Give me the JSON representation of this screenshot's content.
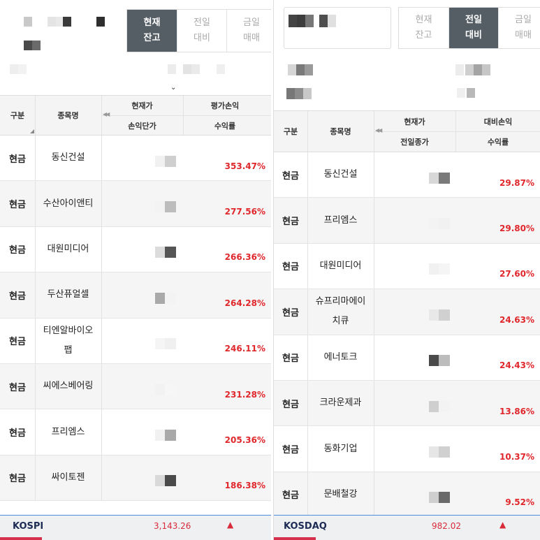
{
  "left": {
    "tabs": [
      {
        "label": "현재\n잔고",
        "active": true
      },
      {
        "label": "전일\n대비",
        "active": false
      },
      {
        "label": "금일\n매매",
        "active": false
      }
    ],
    "columns": {
      "type": "구분",
      "name": "종목명",
      "col3_top": "현재가",
      "col3_bottom": "손익단가",
      "col4_top": "평가손익",
      "col4_bottom": "수익률"
    },
    "rows": [
      {
        "type": "현금",
        "name": "동신건설",
        "rate": "353.47%"
      },
      {
        "type": "현금",
        "name": "수산아이앤티",
        "rate": "277.56%"
      },
      {
        "type": "현금",
        "name": "대원미디어",
        "rate": "266.36%"
      },
      {
        "type": "현금",
        "name": "두산퓨얼셀",
        "rate": "264.28%"
      },
      {
        "type": "현금",
        "name": "티엔알바이오\n팹",
        "rate": "246.11%"
      },
      {
        "type": "현금",
        "name": "씨에스베어링",
        "rate": "231.28%"
      },
      {
        "type": "현금",
        "name": "프리엠스",
        "rate": "205.36%"
      },
      {
        "type": "현금",
        "name": "싸이토젠",
        "rate": "186.38%"
      }
    ],
    "footer": {
      "index_name": "KOSPI",
      "index_value": "3,143.26",
      "direction_icon": "up-triangle-icon"
    }
  },
  "right": {
    "tabs": [
      {
        "label": "현재\n잔고",
        "active": false
      },
      {
        "label": "전일\n대비",
        "active": true
      },
      {
        "label": "금일\n매매",
        "active": false
      }
    ],
    "columns": {
      "type": "구분",
      "name": "종목명",
      "col3_top": "현재가",
      "col3_bottom": "전일종가",
      "col4_top": "대비손익",
      "col4_bottom": "수익률"
    },
    "rows": [
      {
        "type": "현금",
        "name": "동신건설",
        "rate": "29.87%"
      },
      {
        "type": "현금",
        "name": "프리엠스",
        "rate": "29.80%"
      },
      {
        "type": "현금",
        "name": "대원미디어",
        "rate": "27.60%"
      },
      {
        "type": "현금",
        "name": "슈프리마에이\n치큐",
        "rate": "24.63%"
      },
      {
        "type": "현금",
        "name": "에너토크",
        "rate": "24.43%"
      },
      {
        "type": "현금",
        "name": "크라운제과",
        "rate": "13.86%"
      },
      {
        "type": "현금",
        "name": "동화기업",
        "rate": "10.37%"
      },
      {
        "type": "현금",
        "name": "문배철강",
        "rate": "9.52%"
      }
    ],
    "footer": {
      "index_name": "KOSDAQ",
      "index_value": "982.02",
      "direction_icon": "up-triangle-icon"
    }
  },
  "colors": {
    "accent": "#555d65",
    "profit": "#e0272c",
    "index_line": "#4a8fd6",
    "footer_bar": "#d6304f"
  }
}
